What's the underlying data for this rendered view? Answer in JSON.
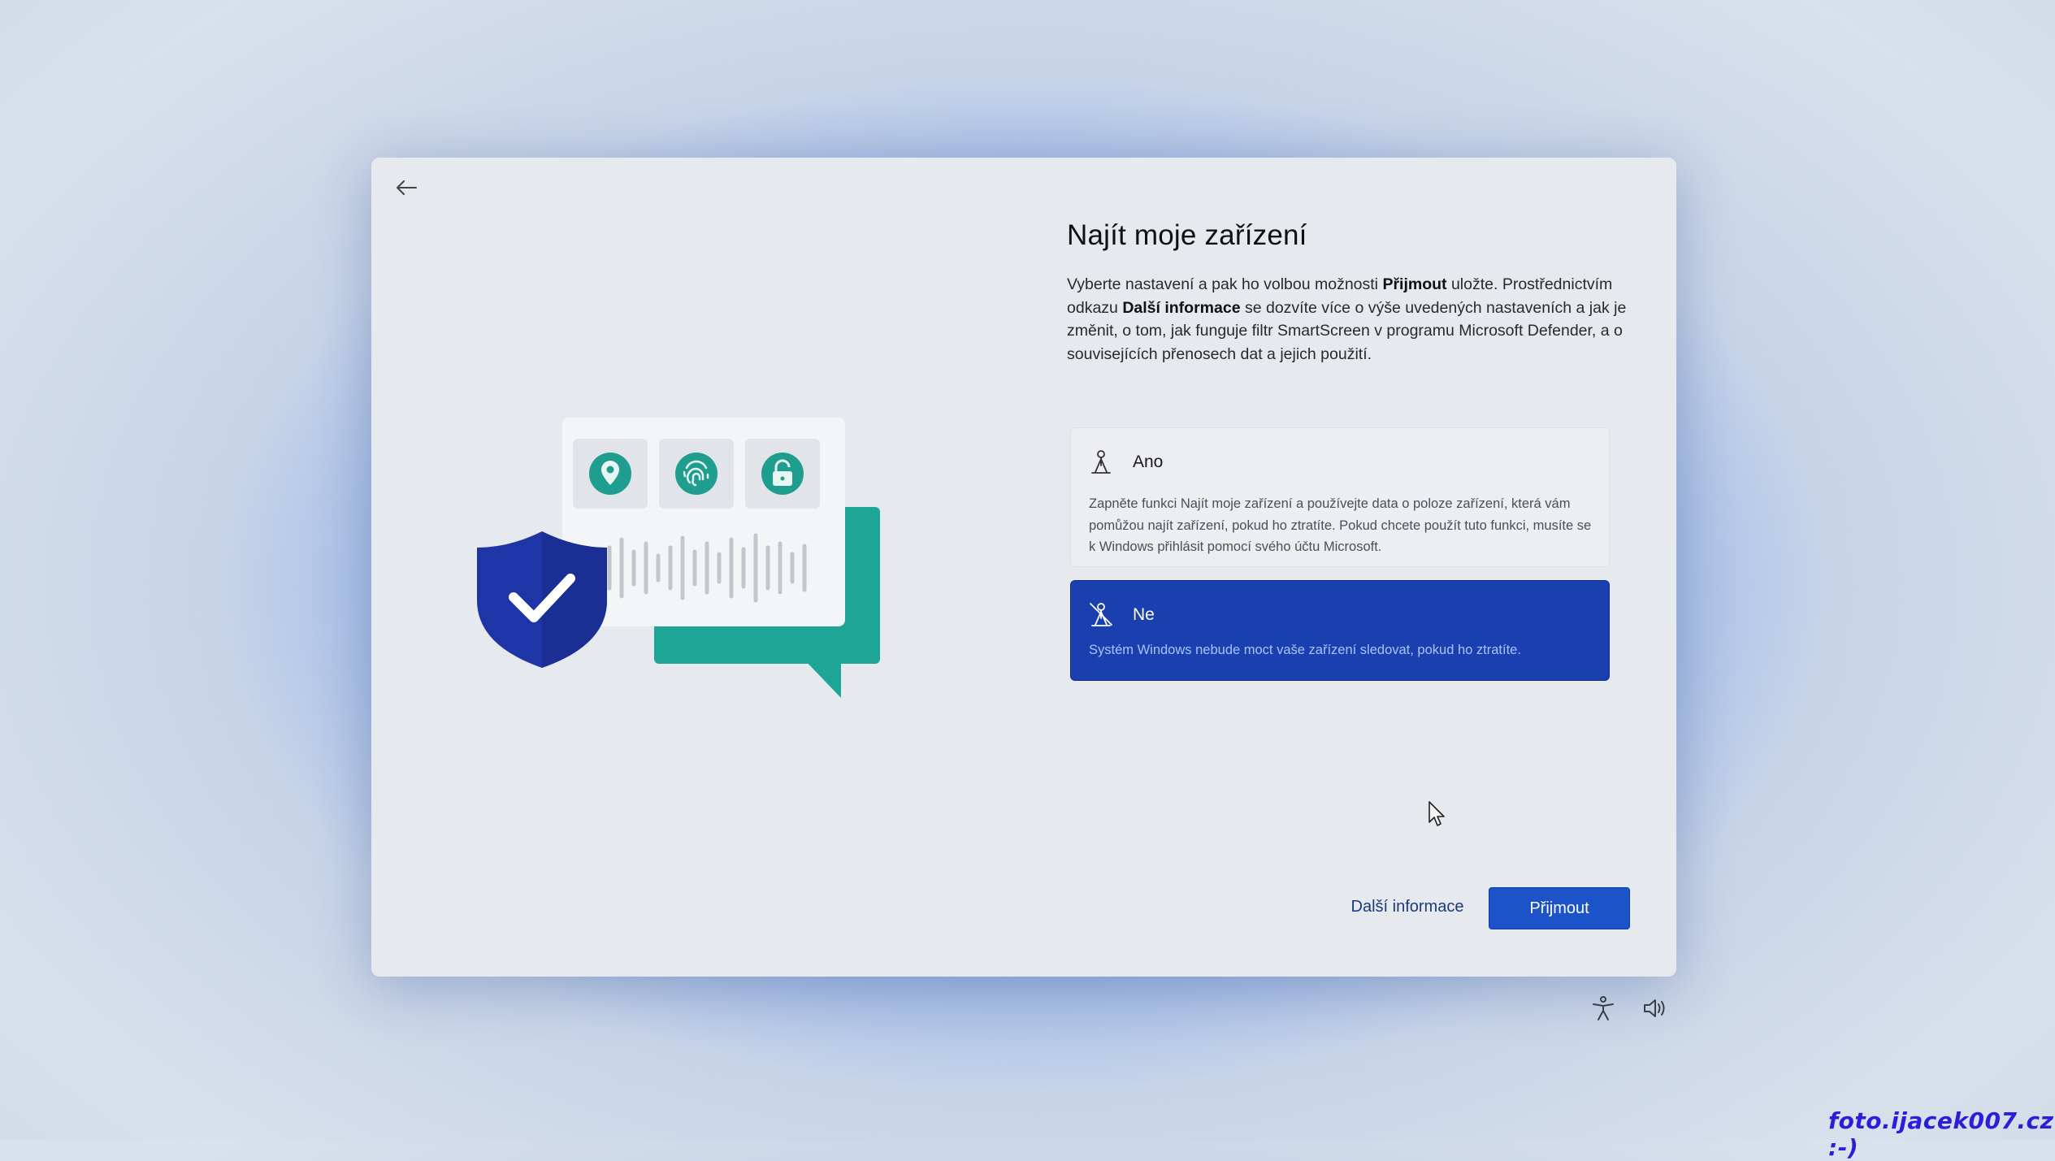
{
  "dialog": {
    "title": "Najít moje zařízení",
    "description": {
      "p1": "Vyberte nastavení a pak ho volbou možnosti ",
      "accept_ref": "Přijmout",
      "p2": " uložte. Prostřednictvím odkazu ",
      "learn_more_ref": "Další informace",
      "p3": " se dozvíte více o výše uvedených nastaveních a jak je změnit, o tom, jak funguje filtr SmartScreen v programu Microsoft Defender, a o souvisejících přenosech dat a jejich použití."
    },
    "options": [
      {
        "label": "Ano",
        "description": "Zapněte funkci Najít moje zařízení a používejte data o poloze zařízení, která vám pomůžou najít zařízení, pokud ho ztratíte. Pokud chcete použít tuto funkci, musíte se k Windows přihlásit pomocí svého účtu Microsoft.",
        "icon": "location-person-icon",
        "selected": false
      },
      {
        "label": "Ne",
        "description": "Systém Windows nebude moct vaše zařízení sledovat, pokud ho ztratíte.",
        "icon": "location-off-icon",
        "selected": true
      }
    ],
    "buttons": {
      "learn_more": "Další informace",
      "accept": "Přijmout"
    }
  },
  "tray": {
    "accessibility_icon": "accessibility-icon",
    "volume_icon": "volume-icon"
  },
  "watermark": "foto.ijacek007.cz :-)",
  "colors": {
    "accent": "#1d53c8",
    "selected_option": "#1a3fae",
    "teal": "#1fa596",
    "shield": "#1e35a8"
  }
}
